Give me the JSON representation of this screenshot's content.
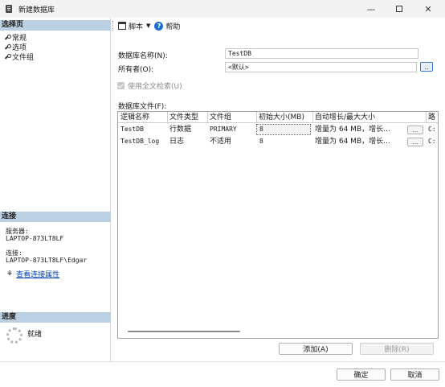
{
  "window": {
    "title": "新建数据库"
  },
  "left_panel": {
    "select_page_header": "选择页",
    "pages": [
      {
        "label": "常规"
      },
      {
        "label": "选项"
      },
      {
        "label": "文件组"
      }
    ],
    "connection_header": "连接",
    "server_label": "服务器:",
    "server_value": "LAPTOP-873LT8LF",
    "connection_label": "连接:",
    "connection_value": "LAPTOP-873LT8LF\\Edgar",
    "view_props_link": "查看连接属性",
    "progress_header": "进度",
    "progress_status": "就绪"
  },
  "toolbar": {
    "script_label": "脚本",
    "help_label": "帮助"
  },
  "form": {
    "db_name_label": "数据库名称(N):",
    "db_name_value": "TestDB",
    "owner_label": "所有者(O):",
    "owner_value": "<默认>",
    "owner_button": "..",
    "fulltext_label": "使用全文检索(U)",
    "fulltext_checked": true,
    "files_label": "数据库文件(F):"
  },
  "files_table": {
    "columns": [
      "逻辑名称",
      "文件类型",
      "文件组",
      "初始大小(MB)",
      "自动增长/最大大小",
      "路"
    ],
    "rows": [
      {
        "logical_name": "TestDB",
        "file_type": "行数据",
        "filegroup": "PRIMARY",
        "initial_size": "8",
        "autogrowth": "增量为 64 MB，增长...",
        "button": "...",
        "path": "C:"
      },
      {
        "logical_name": "TestDB_log",
        "file_type": "日志",
        "filegroup": "不适用",
        "initial_size": "8",
        "autogrowth": "增量为 64 MB，增长...",
        "button": "...",
        "path": "C:"
      }
    ]
  },
  "buttons": {
    "add": "添加(A)",
    "remove": "删除(R)",
    "ok": "确定",
    "cancel": "取消"
  },
  "colors": {
    "section_header": "#bcd0e4",
    "link": "#0645ad",
    "help_icon": "#1e6fd0"
  }
}
